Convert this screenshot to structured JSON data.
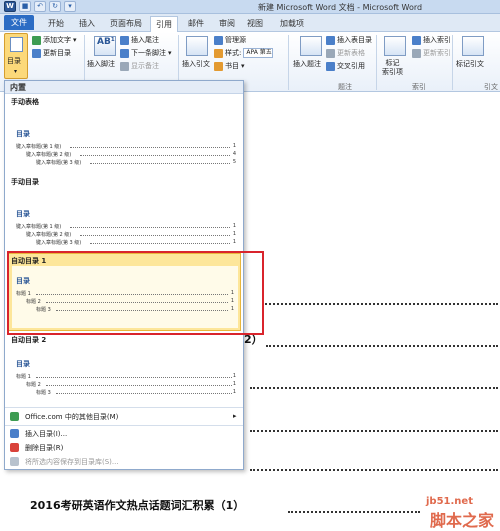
{
  "window": {
    "title": "新建 Microsoft Word 文档 - Microsoft Word"
  },
  "tabs": [
    {
      "label": "文件"
    },
    {
      "label": "开始"
    },
    {
      "label": "插入"
    },
    {
      "label": "页面布局"
    },
    {
      "label": "引用"
    },
    {
      "label": "邮件"
    },
    {
      "label": "审阅"
    },
    {
      "label": "视图"
    },
    {
      "label": "加载项"
    }
  ],
  "ribbon": {
    "toc_button": "目录",
    "add_text": "添加文字",
    "update_toc": "更新目录",
    "insert_footnote": "插入脚注",
    "insert_endnote": "插入尾注",
    "next_footnote": "下一条脚注",
    "show_notes": "显示备注",
    "manage_sources": "管理源",
    "style_label": "样式:",
    "style_value": "APA 第五",
    "insert_citation": "插入引文",
    "bibliography": "书目",
    "insert_caption": "插入题注",
    "insert_table_of_figures": "插入表目录",
    "update_table": "更新表格",
    "cross_reference": "交叉引用",
    "caption_group": "题注",
    "mark_entry": "标记\n索引项",
    "insert_index": "插入索引",
    "update_index": "更新索引",
    "index_group": "索引",
    "mark_citation": "标记引文",
    "citation_group": "引文"
  },
  "gallery": {
    "header": "内置",
    "manual_table": "手动表格",
    "manual_toc": "手动目录",
    "auto_toc1": "自动目录 1",
    "auto_toc2": "自动目录 2",
    "toc_heading": "目录",
    "entry_chapter": "键入章标题(第 1 级)",
    "entry_level2": "键入章标题(第 2 级)",
    "entry_level3": "键入章标题(第 3 级)",
    "heading1": "标题 1",
    "heading2": "标题 2",
    "heading3": "标题 3",
    "num1": "1",
    "num4": "4",
    "num5": "5",
    "footer": {
      "office_more": "Office.com 中的其他目录(M)",
      "insert_toc": "插入目录(I)...",
      "remove_toc": "删除目录(R)",
      "save_selection": "将所选内容保存到目录库(S)..."
    }
  },
  "document": {
    "line_frag": "2）",
    "line_bottom": "2016考研英语作文热点话题词汇积累（1）"
  },
  "watermark": {
    "site": "jb51.net",
    "name": "脚本之家"
  }
}
